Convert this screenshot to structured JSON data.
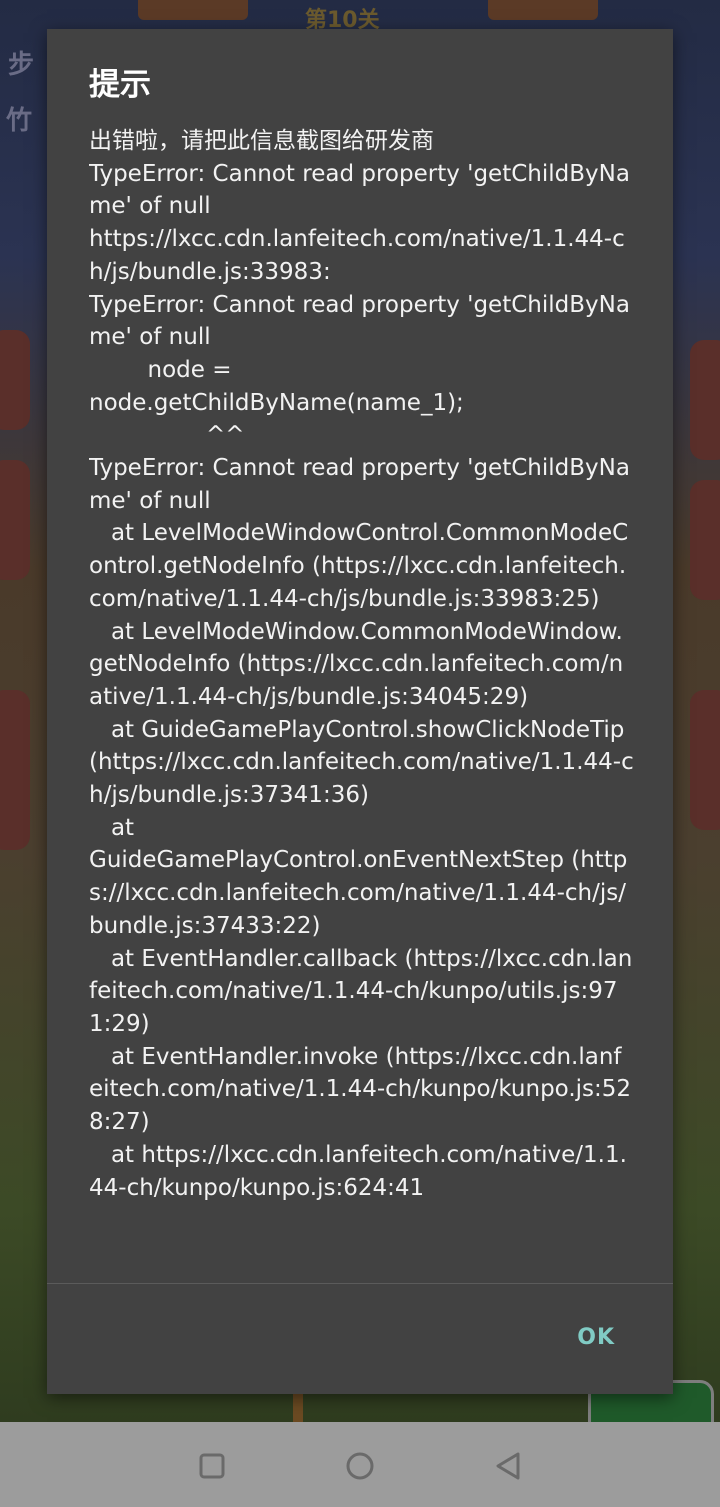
{
  "background": {
    "level_title": "第10关",
    "side_text_1": "步",
    "side_text_2": "竹"
  },
  "dialog": {
    "title": "提示",
    "message": "出错啦，请把此信息截图给研发商\nTypeError: Cannot read property 'getChildByName' of null\nhttps://lxcc.cdn.lanfeitech.com/native/1.1.44-ch/js/bundle.js:33983:\nTypeError: Cannot read property 'getChildByName' of null\n        node =\nnode.getChildByName(name_1);\n                ^^\nTypeError: Cannot read property 'getChildByName' of null\n   at LevelModeWindowControl.CommonModeControl.getNodeInfo (https://lxcc.cdn.lanfeitech.com/native/1.1.44-ch/js/bundle.js:33983:25)\n   at LevelModeWindow.CommonModeWindow.getNodeInfo (https://lxcc.cdn.lanfeitech.com/native/1.1.44-ch/js/bundle.js:34045:29)\n   at GuideGamePlayControl.showClickNodeTip (https://lxcc.cdn.lanfeitech.com/native/1.1.44-ch/js/bundle.js:37341:36)\n   at\nGuideGamePlayControl.onEventNextStep (https://lxcc.cdn.lanfeitech.com/native/1.1.44-ch/js/bundle.js:37433:22)\n   at EventHandler.callback (https://lxcc.cdn.lanfeitech.com/native/1.1.44-ch/kunpo/utils.js:971:29)\n   at EventHandler.invoke (https://lxcc.cdn.lanfeitech.com/native/1.1.44-ch/kunpo/kunpo.js:528:27)\n   at https://lxcc.cdn.lanfeitech.com/native/1.1.44-ch/kunpo/kunpo.js:624:41",
    "ok_label": "OK"
  },
  "colors": {
    "dialog_bg": "#424242",
    "ok_accent": "#80cbc4",
    "nav_bar": "#9c9c9c"
  },
  "icons": {
    "nav_recents": "square-icon",
    "nav_home": "circle-icon",
    "nav_back": "triangle-back-icon"
  }
}
